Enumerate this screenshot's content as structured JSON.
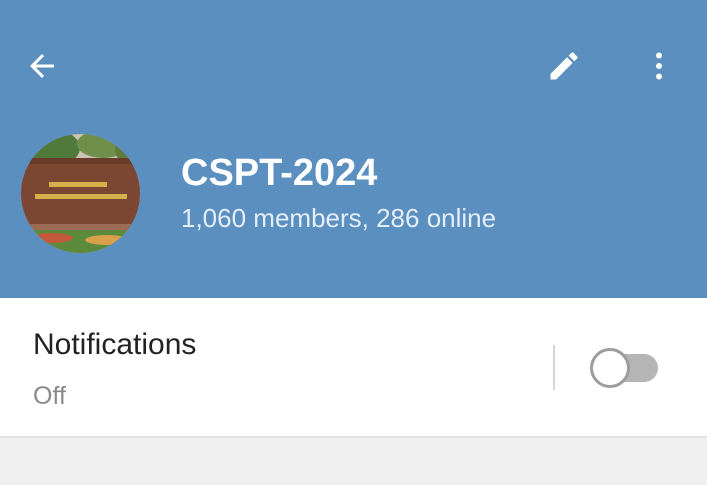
{
  "colors": {
    "header_bg": "#5b8fbf",
    "page_bg": "#f0f0f0",
    "card_bg": "#ffffff"
  },
  "toolbar": {
    "back_icon": "arrow-left-icon",
    "edit_icon": "pencil-icon",
    "more_icon": "more-vertical-icon"
  },
  "group": {
    "title": "CSPT-2024",
    "subtitle": "1,060 members, 286 online"
  },
  "notifications": {
    "label": "Notifications",
    "value": "Off",
    "enabled": false
  }
}
